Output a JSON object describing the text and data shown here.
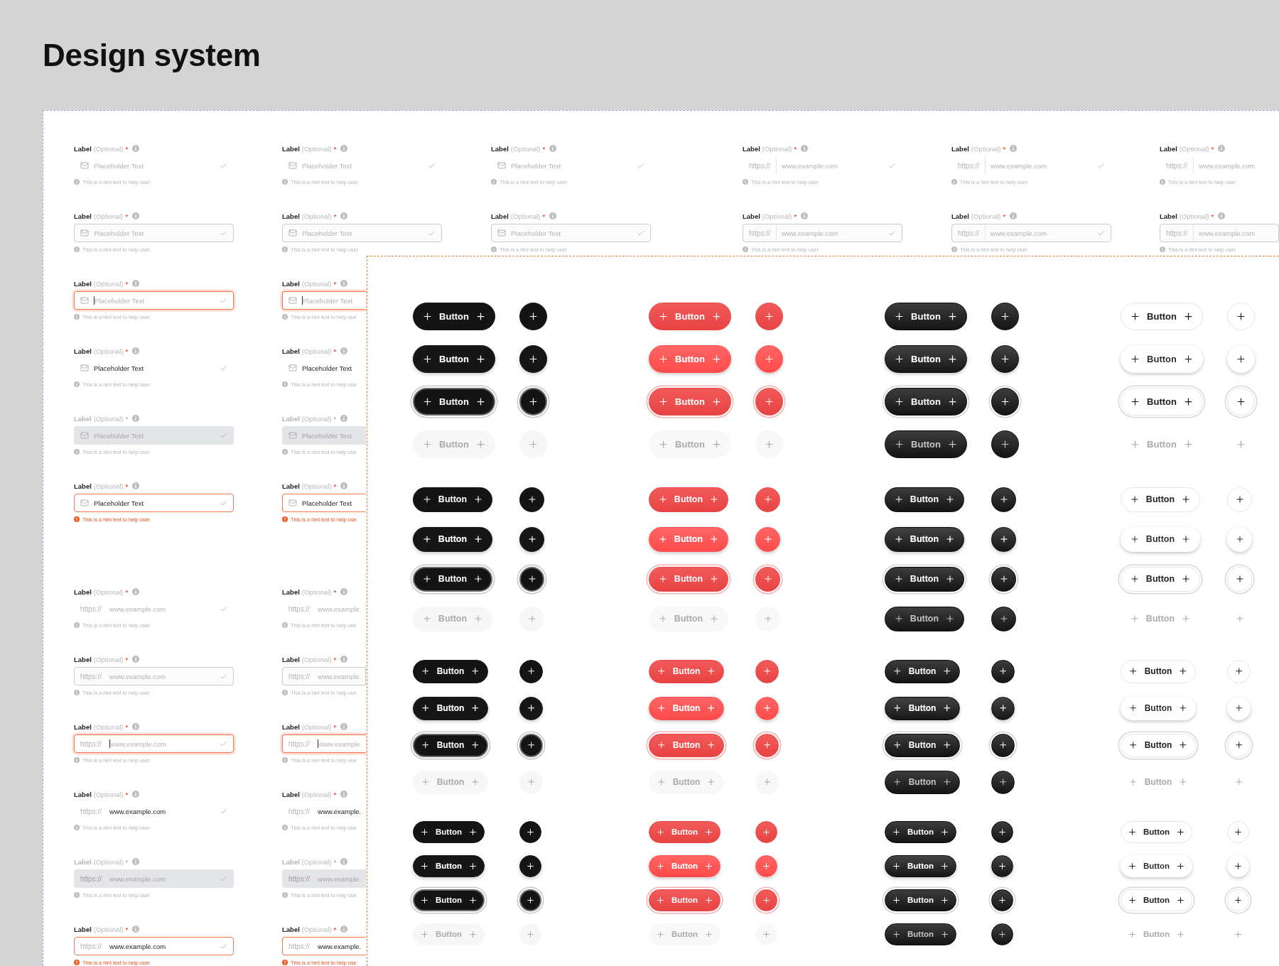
{
  "title": "Design system",
  "field_columns": [
    {
      "groups": [
        {
          "fields": [
            {
              "kind": "email",
              "hovered": false,
              "focused": false,
              "disabled": false,
              "error": false,
              "label": "Label",
              "optional": "(Optional)",
              "required": "*",
              "placeholder": "Placeholder Text",
              "check": true,
              "hint": "This is a hint text to help user"
            },
            {
              "kind": "email",
              "hovered": true,
              "focused": false,
              "disabled": false,
              "error": false,
              "label": "Label",
              "optional": "(Optional)",
              "required": "*",
              "placeholder": "Placeholder Text",
              "check": true,
              "hint": "This is a hint text to help user"
            },
            {
              "kind": "email",
              "hovered": false,
              "focused": true,
              "disabled": false,
              "error": false,
              "label": "Label",
              "optional": "(Optional)",
              "required": "*",
              "placeholder": "Placeholder Text",
              "check": true,
              "hint": "This is a hint text to help user"
            },
            {
              "kind": "email",
              "hovered": false,
              "focused": false,
              "disabled": false,
              "error": false,
              "label": "Label",
              "optional": "(Optional)",
              "required": "*",
              "value": "Placeholder Text",
              "check": true,
              "hint": "This is a hint text to help user"
            },
            {
              "kind": "email",
              "hovered": false,
              "focused": false,
              "disabled": true,
              "error": false,
              "label": "Label",
              "optional": "(Optional)",
              "required": "*",
              "placeholder": "Placeholder Text",
              "check": true,
              "hint": "This is a hint text to help user"
            },
            {
              "kind": "email",
              "hovered": false,
              "focused": false,
              "disabled": false,
              "error": true,
              "label": "Label",
              "optional": "(Optional)",
              "required": "*",
              "value": "Placeholder Text",
              "check": true,
              "hint": "This is a hint text to help user"
            }
          ]
        },
        {
          "fields": [
            {
              "kind": "url",
              "hovered": false,
              "focused": false,
              "disabled": false,
              "error": false,
              "label": "Label",
              "optional": "(Optional)",
              "required": "*",
              "prefix": "https://",
              "placeholder": "www.example.com",
              "check": true,
              "hint": "This is a hint text to help user"
            },
            {
              "kind": "url",
              "hovered": true,
              "focused": false,
              "disabled": false,
              "error": false,
              "label": "Label",
              "optional": "(Optional)",
              "required": "*",
              "prefix": "https://",
              "placeholder": "www.example.com",
              "check": true,
              "hint": "This is a hint text to help user"
            },
            {
              "kind": "url",
              "hovered": false,
              "focused": true,
              "disabled": false,
              "error": false,
              "label": "Label",
              "optional": "(Optional)",
              "required": "*",
              "prefix": "https://",
              "placeholder": "www.example.com",
              "check": true,
              "hint": "This is a hint text to help user"
            },
            {
              "kind": "url",
              "hovered": false,
              "focused": false,
              "disabled": false,
              "error": false,
              "label": "Label",
              "optional": "(Optional)",
              "required": "*",
              "prefix": "https://",
              "value": "www.example.com",
              "check": true,
              "hint": "This is a hint text to help user"
            },
            {
              "kind": "url",
              "hovered": false,
              "focused": false,
              "disabled": true,
              "error": false,
              "label": "Label",
              "optional": "(Optional)",
              "required": "*",
              "prefix": "https://",
              "placeholder": "www.example.com",
              "check": true,
              "hint": "This is a hint text to help user"
            },
            {
              "kind": "url",
              "hovered": false,
              "focused": false,
              "disabled": false,
              "error": true,
              "label": "Label",
              "optional": "(Optional)",
              "required": "*",
              "prefix": "https://",
              "value": "www.example.com",
              "check": true,
              "hint": "This is a hint text to help user"
            }
          ]
        }
      ]
    },
    {
      "groups": [
        {
          "fields": [
            {
              "kind": "email",
              "hovered": false,
              "focused": false,
              "disabled": false,
              "error": false,
              "label": "Label",
              "optional": "(Optional)",
              "required": "*",
              "placeholder": "Placeholder Text",
              "check": true,
              "hint": "This is a hint text to help user"
            },
            {
              "kind": "email",
              "hovered": true,
              "focused": false,
              "disabled": false,
              "error": false,
              "label": "Label",
              "optional": "(Optional)",
              "required": "*",
              "placeholder": "Placeholder Text",
              "check": true,
              "hint": "This is a hint text to help user"
            },
            {
              "kind": "email",
              "hovered": false,
              "focused": true,
              "disabled": false,
              "error": false,
              "label": "Label",
              "optional": "(Optional)",
              "required": "*",
              "placeholder": "Placeholder Text",
              "hint": "This is a hint text to help use"
            },
            {
              "kind": "email",
              "hovered": false,
              "focused": false,
              "disabled": false,
              "error": false,
              "label": "Label",
              "optional": "(Optional)",
              "required": "*",
              "value": "Placeholder Text",
              "hint": "This is a hint text to help use"
            },
            {
              "kind": "email",
              "hovered": false,
              "focused": false,
              "disabled": true,
              "error": false,
              "label": "Label",
              "optional": "(Optional)",
              "required": "*",
              "placeholder": "Placeholder Text",
              "hint": "This is a hint text to help use"
            },
            {
              "kind": "email",
              "hovered": false,
              "focused": false,
              "disabled": false,
              "error": true,
              "label": "Label",
              "optional": "(Optional)",
              "required": "*",
              "value": "Placeholder Text",
              "hint": "This is a hint text to help use"
            }
          ]
        },
        {
          "fields": [
            {
              "kind": "url",
              "hovered": false,
              "focused": false,
              "disabled": false,
              "error": false,
              "label": "Label",
              "optional": "(Optional)",
              "required": "*",
              "prefix": "https://",
              "placeholder": "www.example.",
              "hint": "This is a hint text to help use"
            },
            {
              "kind": "url",
              "hovered": true,
              "focused": false,
              "disabled": false,
              "error": false,
              "label": "Label",
              "optional": "(Optional)",
              "required": "*",
              "prefix": "https://",
              "placeholder": "www.example.",
              "hint": "This is a hint text to help use"
            },
            {
              "kind": "url",
              "hovered": false,
              "focused": true,
              "disabled": false,
              "error": false,
              "label": "Label",
              "optional": "(Optional)",
              "required": "*",
              "prefix": "https://",
              "placeholder": "www.example.",
              "hint": "This is a hint text to help use"
            },
            {
              "kind": "url",
              "hovered": false,
              "focused": false,
              "disabled": false,
              "error": false,
              "label": "Label",
              "optional": "(Optional)",
              "required": "*",
              "prefix": "https://",
              "value": "www.example.",
              "hint": "This is a hint text to help use"
            },
            {
              "kind": "url",
              "hovered": false,
              "focused": false,
              "disabled": true,
              "error": false,
              "label": "Label",
              "optional": "(Optional)",
              "required": "*",
              "prefix": "https://",
              "placeholder": "www.example.",
              "hint": "This is a hint text to help use"
            },
            {
              "kind": "url",
              "hovered": false,
              "focused": false,
              "disabled": false,
              "error": true,
              "label": "Label",
              "optional": "(Optional)",
              "required": "*",
              "prefix": "https://",
              "value": "www.example.",
              "hint": "This is a hint text to help use"
            }
          ]
        }
      ]
    },
    {
      "groups": [
        {
          "fields": [
            {
              "kind": "email",
              "hovered": false,
              "focused": false,
              "disabled": false,
              "error": false,
              "label": "Label",
              "optional": "(Optional)",
              "required": "*",
              "placeholder": "Placeholder Text",
              "check": true,
              "hint": "This is a hint text to help user"
            },
            {
              "kind": "email",
              "hovered": true,
              "focused": false,
              "disabled": false,
              "error": false,
              "label": "Label",
              "optional": "(Optional)",
              "required": "*",
              "placeholder": "Placeholder Text",
              "check": true,
              "hint": "This is a hint text to help user"
            }
          ]
        }
      ]
    },
    {
      "groups": [
        {
          "fields": [
            {
              "kind": "url-addon",
              "hovered": false,
              "focused": false,
              "disabled": false,
              "error": false,
              "label": "Label",
              "optional": "(Optional)",
              "required": "*",
              "prefix": "https://",
              "placeholder": "www.example.com",
              "check": true,
              "hint": "This is a hint text to help user"
            },
            {
              "kind": "url-addon",
              "hovered": true,
              "focused": false,
              "disabled": false,
              "error": false,
              "label": "Label",
              "optional": "(Optional)",
              "required": "*",
              "prefix": "https://",
              "placeholder": "www.example.com",
              "check": true,
              "hint": "This is a hint text to help user"
            }
          ]
        }
      ]
    },
    {
      "groups": [
        {
          "fields": [
            {
              "kind": "url-addon",
              "hovered": false,
              "focused": false,
              "disabled": false,
              "error": false,
              "label": "Label",
              "optional": "(Optional)",
              "required": "*",
              "prefix": "https://",
              "placeholder": "www.example.com",
              "check": true,
              "hint": "This is a hint text to help user"
            },
            {
              "kind": "url-addon",
              "hovered": true,
              "focused": false,
              "disabled": false,
              "error": false,
              "label": "Label",
              "optional": "(Optional)",
              "required": "*",
              "prefix": "https://",
              "placeholder": "www.example.com",
              "check": true,
              "hint": "This is a hint text to help user"
            }
          ]
        }
      ]
    },
    {
      "groups": [
        {
          "fields": [
            {
              "kind": "url-addon",
              "hovered": false,
              "focused": false,
              "disabled": false,
              "error": false,
              "label": "Label",
              "optional": "(Optional)",
              "required": "*",
              "prefix": "https://",
              "placeholder": "www.example.com",
              "hint": "This is a hint text to help user"
            },
            {
              "kind": "url-addon",
              "hovered": true,
              "focused": false,
              "disabled": false,
              "error": false,
              "label": "Label",
              "optional": "(Optional)",
              "required": "*",
              "prefix": "https://",
              "placeholder": "www.example.com",
              "hint": "This is a hint text to help user"
            }
          ]
        }
      ]
    }
  ],
  "button_variants": [
    {
      "kind": "black"
    },
    {
      "kind": "red"
    },
    {
      "kind": "dark"
    },
    {
      "kind": "outline"
    }
  ],
  "button_blocks": [
    {
      "kind": "large",
      "rows": [
        {
          "hovered": false,
          "focused": false,
          "disabled": false,
          "labels": [
            "Button",
            "Button",
            "Button",
            "Button"
          ]
        },
        {
          "hovered": true,
          "focused": false,
          "disabled": false,
          "labels": [
            "Button",
            "Button",
            "Button",
            "Button"
          ]
        },
        {
          "hovered": false,
          "focused": true,
          "disabled": false,
          "labels": [
            "Button",
            "Button",
            "Button",
            "Button"
          ]
        },
        {
          "hovered": false,
          "focused": false,
          "disabled": true,
          "labels": [
            "Button",
            "Button",
            "Button",
            "Button"
          ]
        }
      ]
    },
    {
      "kind": "medium",
      "rows": [
        {
          "hovered": false,
          "focused": false,
          "disabled": false,
          "labels": [
            "Button",
            "Button",
            "Button",
            "Button"
          ]
        },
        {
          "hovered": true,
          "focused": false,
          "disabled": false,
          "labels": [
            "Button",
            "Button",
            "Button",
            "Button"
          ]
        },
        {
          "hovered": false,
          "focused": true,
          "disabled": false,
          "labels": [
            "Button",
            "Button",
            "Button",
            "Button"
          ]
        },
        {
          "hovered": false,
          "focused": false,
          "disabled": true,
          "labels": [
            "Button",
            "Button",
            "Button",
            "Button"
          ]
        }
      ]
    },
    {
      "kind": "small",
      "rows": [
        {
          "hovered": false,
          "focused": false,
          "disabled": false,
          "labels": [
            "Button",
            "Button",
            "Button",
            "Button"
          ]
        },
        {
          "hovered": true,
          "focused": false,
          "disabled": false,
          "labels": [
            "Button",
            "Button",
            "Button",
            "Button"
          ]
        },
        {
          "hovered": false,
          "focused": true,
          "disabled": false,
          "labels": [
            "Button",
            "Button",
            "Button",
            "Button"
          ]
        },
        {
          "hovered": false,
          "focused": false,
          "disabled": true,
          "labels": [
            "Button",
            "Button",
            "Button",
            "Button"
          ]
        }
      ]
    },
    {
      "kind": "xsmall",
      "rows": [
        {
          "hovered": false,
          "focused": false,
          "disabled": false,
          "labels": [
            "Button",
            "Button",
            "Button",
            "Button"
          ]
        },
        {
          "hovered": true,
          "focused": false,
          "disabled": false,
          "labels": [
            "Button",
            "Button",
            "Button",
            "Button"
          ]
        },
        {
          "hovered": false,
          "focused": true,
          "disabled": false,
          "labels": [
            "Button",
            "Button",
            "Button",
            "Button"
          ]
        },
        {
          "hovered": false,
          "focused": false,
          "disabled": true,
          "labels": [
            "Button",
            "Button",
            "Button",
            "Button"
          ]
        }
      ]
    }
  ]
}
